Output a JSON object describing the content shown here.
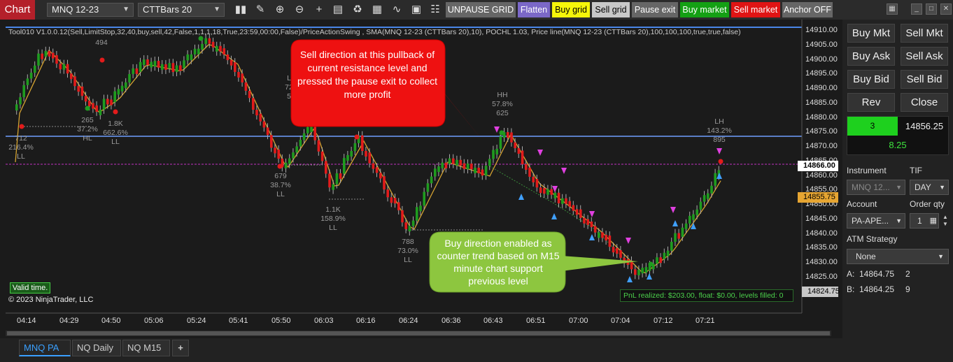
{
  "window": {
    "title": "Chart"
  },
  "toolbar": {
    "instrument": "MNQ 12-23",
    "bartype": "CTTBars 20",
    "buttons": [
      {
        "label": "UNPAUSE GRID",
        "bg": "#666666",
        "fg": "#ffffff"
      },
      {
        "label": "Flatten",
        "bg": "#7b68c8",
        "fg": "#ffffff"
      },
      {
        "label": "Buy grid",
        "bg": "#f5f50a",
        "fg": "#000000"
      },
      {
        "label": "Sell grid",
        "bg": "#c8c8c8",
        "fg": "#000000"
      },
      {
        "label": "Pause exit",
        "bg": "#666666",
        "fg": "#ffffff"
      },
      {
        "label": "Buy market",
        "bg": "#14a014",
        "fg": "#ffffff"
      },
      {
        "label": "Sell market",
        "bg": "#e01414",
        "fg": "#ffffff"
      },
      {
        "label": "Anchor OFF",
        "bg": "#666666",
        "fg": "#ffffff"
      }
    ],
    "icons": [
      "bars-icon",
      "pencil-icon",
      "zoom-in-icon",
      "zoom-out-icon",
      "crosshair-icon",
      "properties-icon",
      "strategies-icon",
      "data-box-icon",
      "indicators-icon",
      "screenshot-icon",
      "templates-icon"
    ]
  },
  "chart": {
    "indicator_text": "Tool010 V1.0.0.12(Sell,LimitStop,32,40,buy,sell,42,False,1,1,1,18,True,23:59,00:00,False)/PriceActionSwing , SMA(MNQ 12-23 (CTTBars 20),10), POCHL 1.03, Price line(MNQ 12-23 (CTTBars 20),100,100,100,true,true,false)",
    "price_labels": [
      "14910.00",
      "14905.00",
      "14900.00",
      "14895.00",
      "14890.00",
      "14885.00",
      "14880.00",
      "14875.00",
      "14870.00",
      "14865.00",
      "14860.00",
      "14855.00",
      "14850.00",
      "14845.00",
      "14840.00",
      "14835.00",
      "14830.00",
      "14825.00"
    ],
    "time_labels": [
      "04:14",
      "04:29",
      "04:50",
      "05:06",
      "05:24",
      "05:41",
      "05:50",
      "06:03",
      "06:16",
      "06:24",
      "06:36",
      "06:43",
      "06:51",
      "07:00",
      "07:04",
      "07:12",
      "07:21"
    ],
    "price_tags": [
      {
        "value": "14866.00",
        "bg": "#ffffff"
      },
      {
        "value": "14855.75",
        "bg": "#e6a532"
      },
      {
        "value": "14824.75",
        "bg": "#c8c8c8"
      }
    ],
    "swing_labels": [
      {
        "text": [
          "712",
          "216.4%",
          "LL"
        ]
      },
      {
        "text": [
          "265",
          "37.2%",
          "HL"
        ]
      },
      {
        "text": [
          "1.8K",
          "662.6%",
          "LL"
        ]
      },
      {
        "text": [
          "494"
        ]
      },
      {
        "text": [
          "679",
          "38.7%",
          "LL"
        ]
      },
      {
        "text": [
          "1.1K",
          "158.9%",
          "LL"
        ]
      },
      {
        "text": [
          "788",
          "73.0%",
          "LL"
        ]
      },
      {
        "text": [
          "HH",
          "57.8%",
          "625"
        ]
      },
      {
        "text": [
          "LH",
          "143.2%",
          "895"
        ]
      },
      {
        "text": [
          "L",
          "72",
          "5"
        ]
      }
    ],
    "callout_sell": "Sell direction at this pullback of current resistance level and pressed the pause exit to collect more profit",
    "callout_buy": "Buy direction enabled as counter trend based on M15 minute chart support previous level",
    "valid_time": "Valid time.",
    "copyright": "© 2023 NinjaTrader, LLC",
    "pnl": "PnL realized: $203.00, float: $0.00, levels filled: 0"
  },
  "panel": {
    "buttons": [
      [
        "Buy Mkt",
        "Sell Mkt"
      ],
      [
        "Buy Ask",
        "Sell Ask"
      ],
      [
        "Buy Bid",
        "Sell Bid"
      ],
      [
        "Rev",
        "Close"
      ]
    ],
    "position_qty": "3",
    "position_price": "14856.25",
    "position_pnl": "8.25",
    "instrument_label": "Instrument",
    "instrument_value": "MNQ 12...",
    "tif_label": "TIF",
    "tif_value": "DAY",
    "account_label": "Account",
    "account_value": "PA-APE...",
    "order_qty_label": "Order qty",
    "order_qty_value": "1",
    "atm_label": "ATM Strategy",
    "atm_value": "None",
    "ask_label": "A:",
    "ask_price": "14864.75",
    "ask_size": "2",
    "bid_label": "B:",
    "bid_price": "14864.25",
    "bid_size": "9"
  },
  "tabs": [
    {
      "label": "MNQ PA",
      "active": true
    },
    {
      "label": "NQ Daily",
      "active": false
    },
    {
      "label": "NQ M15",
      "active": false
    }
  ],
  "add_tab": "+"
}
